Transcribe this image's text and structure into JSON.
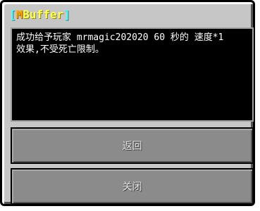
{
  "dialog": {
    "title": {
      "left_bracket": "[",
      "m": "M",
      "rest": "Buffer",
      "right_bracket": "]"
    },
    "message_lines": [
      "成功给予玩家 mrmagic202020 60 秒的 速度*1",
      "效果,不受死亡限制。"
    ],
    "buttons": {
      "back_label": "返回",
      "close_label": "关闭"
    }
  },
  "colors": {
    "panel": "#c6c6c6",
    "message_bg": "#000000",
    "button_bg": "#8b8b8b",
    "title_bracket": "#55ffff",
    "title_m": "#ffaa00",
    "title_rest": "#ffff55"
  }
}
